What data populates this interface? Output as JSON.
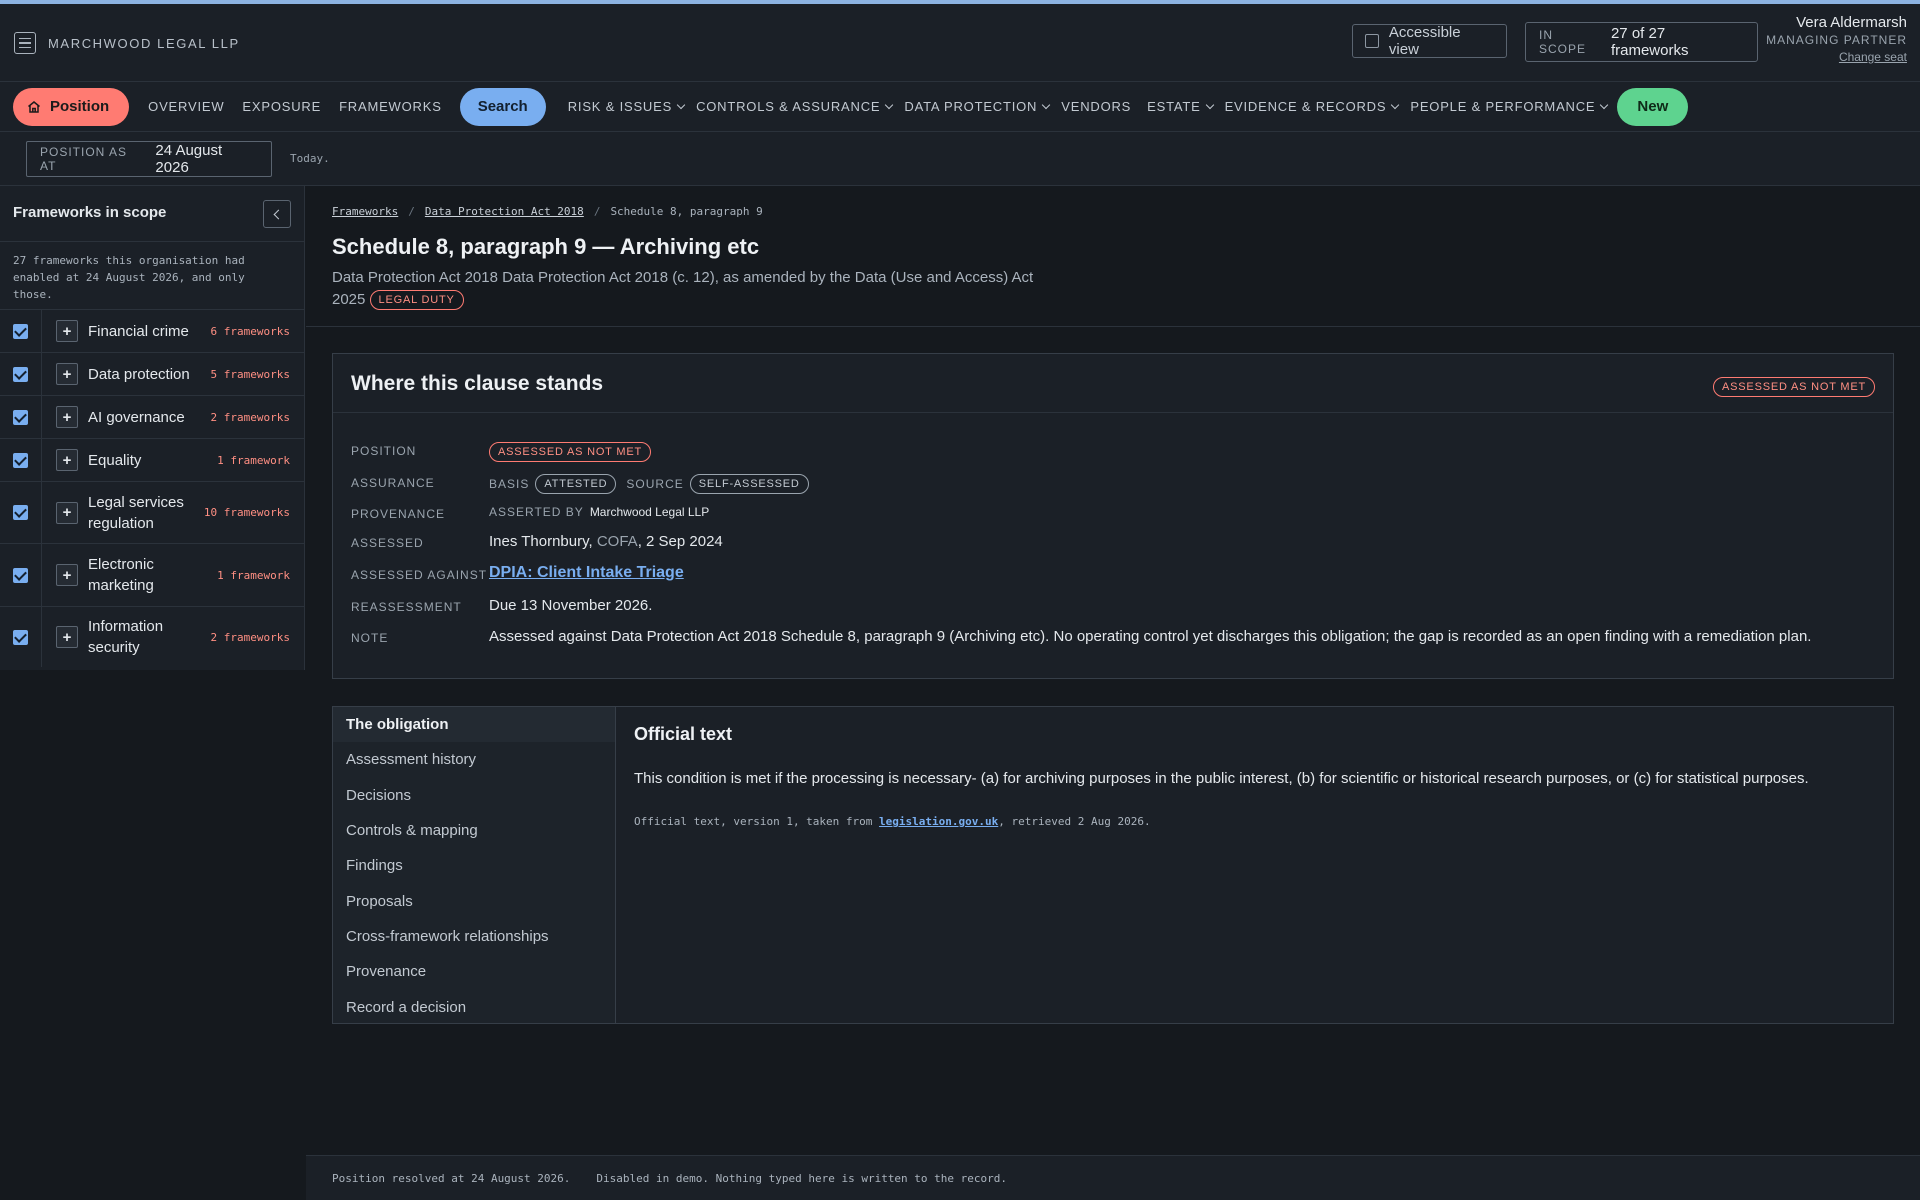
{
  "header": {
    "brand": "MARCHWOOD LEGAL LLP",
    "accessible_view": "Accessible view",
    "scope_label": "IN SCOPE",
    "scope_value": "27 of 27 frameworks",
    "user_name": "Vera Aldermarsh",
    "user_role": "MANAGING PARTNER",
    "change_seat": "Change seat"
  },
  "nav": {
    "position": "Position",
    "overview": "OVERVIEW",
    "exposure": "EXPOSURE",
    "frameworks": "FRAMEWORKS",
    "search": "Search",
    "risk": "RISK & ISSUES",
    "controls": "CONTROLS & ASSURANCE",
    "data_protection": "DATA PROTECTION",
    "vendors": "VENDORS",
    "estate": "ESTATE",
    "evidence": "EVIDENCE & RECORDS",
    "people": "PEOPLE & PERFORMANCE",
    "new": "New"
  },
  "datebar": {
    "label": "POSITION AS AT",
    "value": "24 August 2026",
    "note": "Today."
  },
  "sidebar": {
    "title": "Frameworks in scope",
    "description": "27 frameworks this organisation had enabled at 24 August 2026, and only those.",
    "items": [
      {
        "label": "Financial crime",
        "count": "6 frameworks"
      },
      {
        "label": "Data protection",
        "count": "5 frameworks"
      },
      {
        "label": "AI governance",
        "count": "2 frameworks"
      },
      {
        "label": "Equality",
        "count": "1 framework"
      },
      {
        "label": "Legal services regulation",
        "count": "10 frameworks"
      },
      {
        "label": "Electronic marketing",
        "count": "1 framework"
      },
      {
        "label": "Information security",
        "count": "2 frameworks"
      }
    ]
  },
  "breadcrumb": [
    "Frameworks",
    "Data Protection Act 2018",
    "Schedule 8, paragraph 9"
  ],
  "page": {
    "title": "Schedule 8, paragraph 9 — Archiving etc",
    "subtitle": "Data Protection Act 2018 Data Protection Act 2018 (c. 12), as amended by the Data (Use and Access) Act 2025",
    "badge": "LEGAL DUTY"
  },
  "clause": {
    "title": "Where this clause stands",
    "status_badge": "ASSESSED AS NOT MET",
    "rows": {
      "position_k": "POSITION",
      "position_v": "ASSESSED AS NOT MET",
      "assurance_k": "ASSURANCE",
      "basis_k": "BASIS",
      "basis_v": "ATTESTED",
      "source_k": "SOURCE",
      "source_v": "SELF-ASSESSED",
      "provenance_k": "PROVENANCE",
      "asserted_by_k": "ASSERTED BY",
      "asserted_by_v": "Marchwood Legal LLP",
      "assessed_k": "ASSESSED",
      "assessed_name": "Ines Thornbury,",
      "assessed_role": "COFA",
      "assessed_date": ", 2 Sep 2024",
      "against_k": "ASSESSED AGAINST",
      "against_v": "DPIA: Client Intake Triage",
      "reassess_k": "REASSESSMENT",
      "reassess_v": "Due 13 November 2026.",
      "note_k": "NOTE",
      "note_v": "Assessed against Data Protection Act 2018 Schedule 8, paragraph 9 (Archiving etc). No operating control yet discharges this obligation; the gap is recorded as an open finding with a remediation plan."
    }
  },
  "tabs": [
    "The obligation",
    "Assessment history",
    "Decisions",
    "Controls & mapping",
    "Findings",
    "Proposals",
    "Cross-framework relationships",
    "Provenance",
    "Record a decision"
  ],
  "official": {
    "title": "Official text",
    "text": "This condition is met if the processing is necessary- (a) for archiving purposes in the public interest, (b) for scientific or historical research purposes, or (c) for statistical purposes.",
    "source_prefix": "Official text, version 1, taken from ",
    "source_link": "legislation.gov.uk",
    "source_suffix": ", retrieved 2 Aug 2026."
  },
  "footer": {
    "resolved": "Position resolved at 24 August 2026.",
    "disabled": "Disabled in demo. Nothing typed here is written to the record."
  },
  "colors": {
    "accent_red": "#ff7b72",
    "accent_blue": "#79aef0",
    "accent_green": "#5ed38f"
  }
}
